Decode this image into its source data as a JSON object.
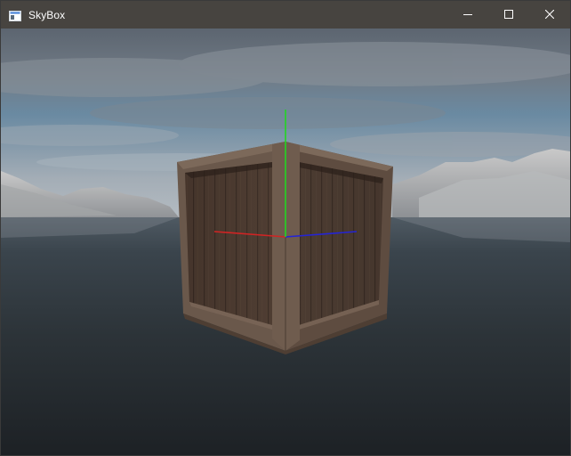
{
  "window": {
    "title": "SkyBox",
    "icon": "app-window-icon",
    "controls": {
      "minimize_icon": "minimize-icon",
      "maximize_icon": "maximize-icon",
      "close_icon": "close-icon"
    }
  },
  "scene": {
    "description_icons": [
      "skybox-sky",
      "mountains",
      "water",
      "wooden-crate",
      "axis-gizmo"
    ],
    "colors": {
      "titlebar": "#474440",
      "sky_top": "#5d6670",
      "sky_blue": "#6f93ad",
      "water": "#2d3338",
      "crate": "#4a3a30",
      "axis_x": "#d02020",
      "axis_y": "#20d020",
      "axis_z": "#2020d0"
    }
  }
}
